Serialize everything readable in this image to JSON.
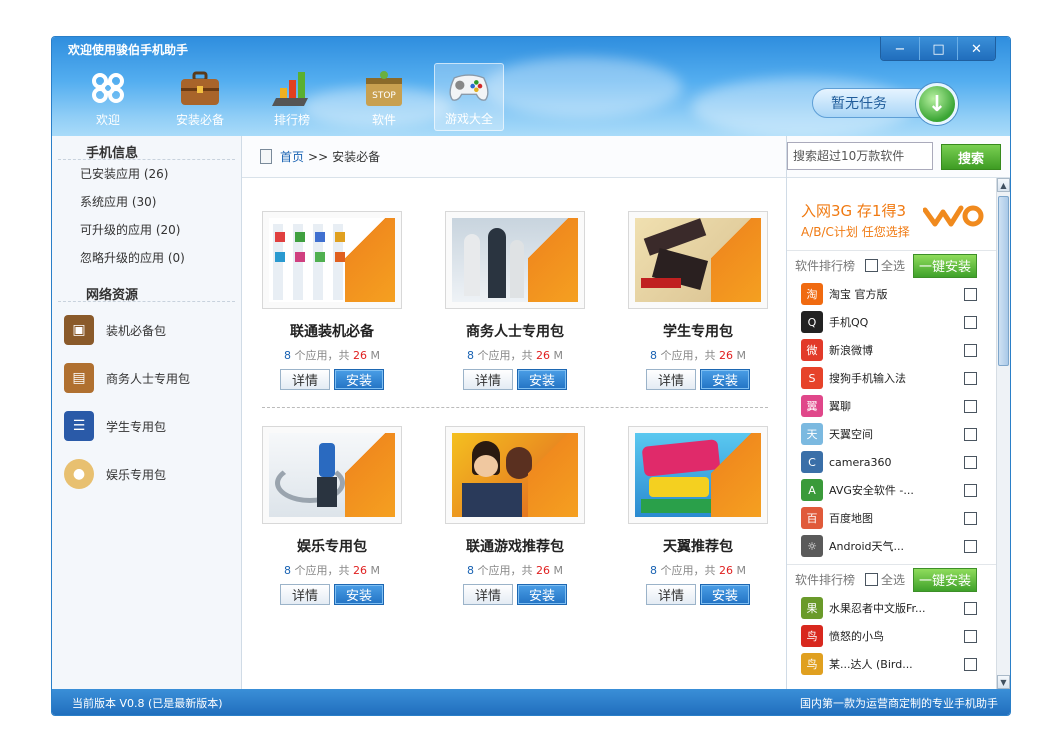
{
  "window": {
    "title": "欢迎使用骏伯手机助手",
    "minimize": "−",
    "maximize": "□",
    "close": "✕"
  },
  "toolbar": {
    "items": [
      {
        "label": "欢迎",
        "icon": "unicom-logo-icon"
      },
      {
        "label": "安装必备",
        "icon": "briefcase-icon"
      },
      {
        "label": "排行榜",
        "icon": "bar-chart-icon"
      },
      {
        "label": "软件",
        "icon": "store-bag-icon"
      },
      {
        "label": "游戏大全",
        "icon": "gamepad-icon",
        "active": true
      }
    ],
    "task_label": "暂无任务"
  },
  "sidebar": {
    "phone_info_title": "手机信息",
    "phone_links": [
      "已安装应用 (26)",
      "系统应用 (30)",
      "可升级的应用 (20)",
      "忽略升级的应用 (0)"
    ],
    "network_title": "网络资源",
    "packages": [
      {
        "label": "装机必备包",
        "icon": "box-icon"
      },
      {
        "label": "商务人士专用包",
        "icon": "briefcase-icon"
      },
      {
        "label": "学生专用包",
        "icon": "book-icon"
      },
      {
        "label": "娱乐专用包",
        "icon": "palette-icon"
      }
    ]
  },
  "breadcrumb": {
    "home": "首页",
    "separator": ">>",
    "current": "安装必备"
  },
  "search": {
    "placeholder": "搜索超过10万款软件",
    "button": "搜索"
  },
  "cards": [
    {
      "title": "联通装机必备",
      "count": "8",
      "count_suffix": " 个应用，共 ",
      "size": "26",
      "unit": " M",
      "detail": "详情",
      "install": "安装"
    },
    {
      "title": "商务人士专用包",
      "count": "8",
      "count_suffix": " 个应用，共 ",
      "size": "26",
      "unit": " M",
      "detail": "详情",
      "install": "安装"
    },
    {
      "title": "学生专用包",
      "count": "8",
      "count_suffix": " 个应用，共 ",
      "size": "26",
      "unit": " M",
      "detail": "详情",
      "install": "安装"
    },
    {
      "title": "娱乐专用包",
      "count": "8",
      "count_suffix": " 个应用，共 ",
      "size": "26",
      "unit": " M",
      "detail": "详情",
      "install": "安装"
    },
    {
      "title": "联通游戏推荐包",
      "count": "8",
      "count_suffix": " 个应用，共 ",
      "size": "26",
      "unit": " M",
      "detail": "详情",
      "install": "安装"
    },
    {
      "title": "天翼推荐包",
      "count": "8",
      "count_suffix": " 个应用，共 ",
      "size": "26",
      "unit": " M",
      "detail": "详情",
      "install": "安装"
    }
  ],
  "promo": {
    "line1": "入网3G 存1得3",
    "line2": "A/B/C计划 任您选择"
  },
  "rank1": {
    "title": "软件排行榜",
    "select_all": "全选",
    "one_key": "一键安装",
    "apps": [
      {
        "name": "淘宝 官方版",
        "color": "#f06a10",
        "glyph": "淘"
      },
      {
        "name": "手机QQ",
        "color": "#222222",
        "glyph": "Q"
      },
      {
        "name": "新浪微博",
        "color": "#e23a2a",
        "glyph": "微"
      },
      {
        "name": "搜狗手机输入法",
        "color": "#e6432a",
        "glyph": "S"
      },
      {
        "name": "翼聊",
        "color": "#e0478a",
        "glyph": "翼"
      },
      {
        "name": "天翼空间",
        "color": "#7bb9e0",
        "glyph": "天"
      },
      {
        "name": "camera360",
        "color": "#3a6fa8",
        "glyph": "C"
      },
      {
        "name": "AVG安全软件 -...",
        "color": "#3a9a3a",
        "glyph": "A"
      },
      {
        "name": "百度地图",
        "color": "#e05a3a",
        "glyph": "百"
      },
      {
        "name": "Android天气...",
        "color": "#5a5a5a",
        "glyph": "☼"
      }
    ]
  },
  "rank2": {
    "title": "软件排行榜",
    "select_all": "全选",
    "one_key": "一键安装",
    "apps": [
      {
        "name": "水果忍者中文版Fr...",
        "color": "#6a9a2a",
        "glyph": "果"
      },
      {
        "name": "愤怒的小鸟",
        "color": "#d8281e",
        "glyph": "鸟"
      },
      {
        "name": "某...达人 (Bird...",
        "color": "#e0a020",
        "glyph": "鸟"
      }
    ]
  },
  "statusbar": {
    "version": "当前版本 V0.8 (已是最新版本)",
    "slogan": "国内第一款为运营商定制的专业手机助手"
  }
}
